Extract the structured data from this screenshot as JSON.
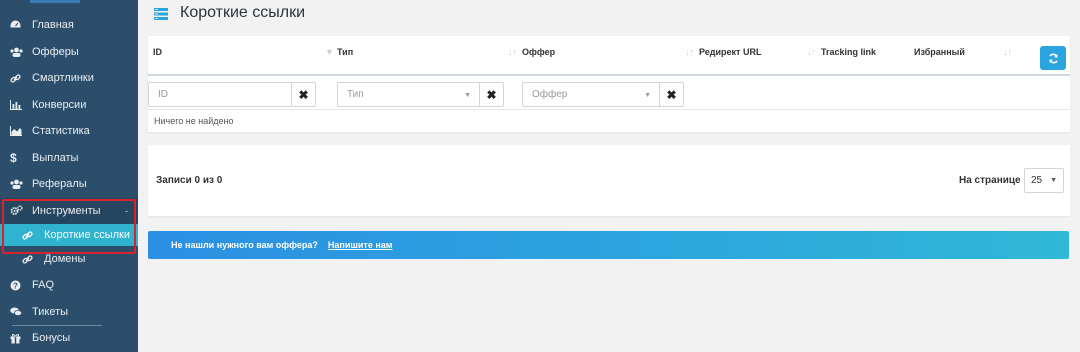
{
  "sidebar": {
    "items": [
      {
        "label": "Главная",
        "icon": "dashboard-icon"
      },
      {
        "label": "Офферы",
        "icon": "users-icon"
      },
      {
        "label": "Смартлинки",
        "icon": "link-icon"
      },
      {
        "label": "Конверсии",
        "icon": "bar-chart-icon"
      },
      {
        "label": "Статистика",
        "icon": "area-chart-icon"
      },
      {
        "label": "Выплаты",
        "icon": "dollar-icon"
      },
      {
        "label": "Рефералы",
        "icon": "users-icon"
      },
      {
        "label": "Инструменты",
        "icon": "gears-icon",
        "caret": "-"
      }
    ],
    "subitems": [
      {
        "label": "Короткие ссылки",
        "icon": "link-icon",
        "active": true
      },
      {
        "label": "Домены",
        "icon": "link-icon"
      }
    ],
    "bottom_items": [
      {
        "label": "FAQ",
        "icon": "question-circle-icon"
      },
      {
        "label": "Тикеты",
        "icon": "comments-icon"
      },
      {
        "label": "Бонусы",
        "icon": "gift-icon"
      }
    ]
  },
  "page": {
    "title": "Короткие ссылки"
  },
  "table": {
    "columns": [
      "ID",
      "Тип",
      "Оффер",
      "Редирект URL",
      "Tracking link",
      "Избранный"
    ],
    "filters": {
      "id_placeholder": "ID",
      "type_placeholder": "Тип",
      "offer_placeholder": "Оффер",
      "clear_glyph": "✖"
    },
    "empty_text": "Ничего не найдено"
  },
  "pager": {
    "records": "Записи 0 из 0",
    "per_page_label": "На странице",
    "per_page_value": "25"
  },
  "banner": {
    "text": "Не нашли нужного вам оффера?",
    "link": "Напишите нам"
  },
  "colors": {
    "sidebar_bg": "#2c4e6b",
    "active_item": "#2fb3cf",
    "accent": "#2aa5e0",
    "highlight": "#d9232d"
  }
}
